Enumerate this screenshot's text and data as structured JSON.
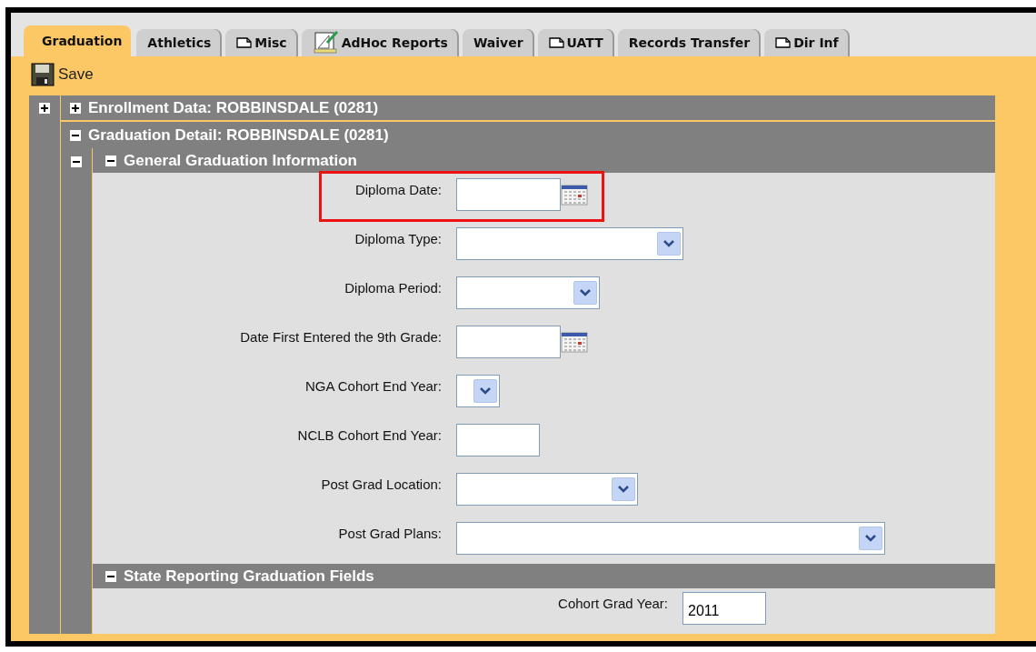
{
  "tabs": [
    {
      "label": "Graduation",
      "selected": true
    },
    {
      "label": "Athletics",
      "selected": false
    },
    {
      "label": "Misc",
      "selected": false
    },
    {
      "label": "AdHoc Reports",
      "selected": false
    },
    {
      "label": "Waiver",
      "selected": false
    },
    {
      "label": "UATT",
      "selected": false
    },
    {
      "label": "Records Transfer",
      "selected": false
    },
    {
      "label": "Dir Inf",
      "selected": false
    }
  ],
  "toolbar": {
    "save": "Save"
  },
  "outer_toggle": {
    "expanded": false
  },
  "enrollment": {
    "title": "Enrollment Data: ROBBINSDALE (0281)",
    "expanded": false
  },
  "graduation_detail": {
    "title": "Graduation Detail: ROBBINSDALE (0281)",
    "expanded": true,
    "inner_toggle": {
      "expanded": true
    },
    "subsections": [
      {
        "title": "General Graduation Information",
        "expanded": true,
        "fields": [
          {
            "label": "Diploma Date:",
            "kind": "date",
            "highlighted": true
          },
          {
            "label": "Diploma Type:",
            "kind": "select"
          },
          {
            "label": "Diploma Period:",
            "kind": "select"
          },
          {
            "label": "Date First Entered the 9th Grade:",
            "kind": "date"
          },
          {
            "label": "NGA Cohort End Year:",
            "kind": "select"
          },
          {
            "label": "NCLB Cohort End Year:",
            "kind": "text"
          },
          {
            "label": "Post Grad Location:",
            "kind": "select"
          },
          {
            "label": "Post Grad Plans:",
            "kind": "select"
          }
        ]
      },
      {
        "title": "State Reporting Graduation Fields",
        "expanded": true,
        "fields": [
          {
            "label": "Cohort Grad Year:",
            "kind": "text",
            "value": "2011"
          }
        ]
      }
    ]
  }
}
